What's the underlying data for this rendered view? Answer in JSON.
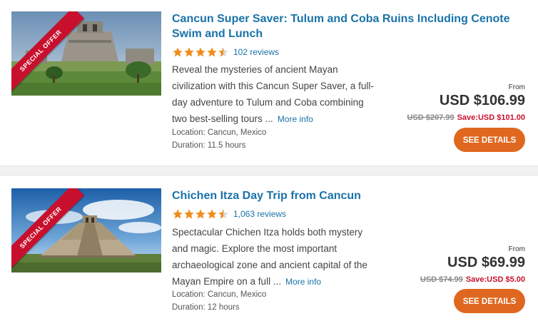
{
  "listings": [
    {
      "ribbon": "SPECIAL OFFER",
      "title": "Cancun Super Saver: Tulum and Coba Ruins Including Cenote Swim and Lunch",
      "rating": 4.5,
      "reviews": "102 reviews",
      "description": "Reveal the mysteries of ancient Mayan civilization with this Cancun Super Saver, a full-day adventure to Tulum and Coba combining two best-selling tours ...",
      "more": "More info",
      "location": "Location: Cancun, Mexico",
      "duration": "Duration: 11.5 hours",
      "from": "From",
      "price": "USD $106.99",
      "old_price": "USD $207.99",
      "save": "Save:USD $101.00",
      "button": "SEE DETAILS"
    },
    {
      "ribbon": "SPECIAL OFFER",
      "title": "Chichen Itza Day Trip from Cancun",
      "rating": 4.5,
      "reviews": "1,063 reviews",
      "description": "Spectacular Chichen Itza holds both mystery and magic. Explore the most important archaeological zone and ancient capital of the Mayan Empire on a full ...",
      "more": "More info",
      "location": "Location: Cancun, Mexico",
      "duration": "Duration: 12 hours",
      "from": "From",
      "price": "USD $69.99",
      "old_price": "USD $74.99",
      "save": "Save:USD $5.00",
      "button": "SEE DETAILS"
    }
  ],
  "colors": {
    "link": "#1a73a8",
    "accent": "#e0671f",
    "ribbon": "#c8102e",
    "star": "#f08c1c"
  }
}
